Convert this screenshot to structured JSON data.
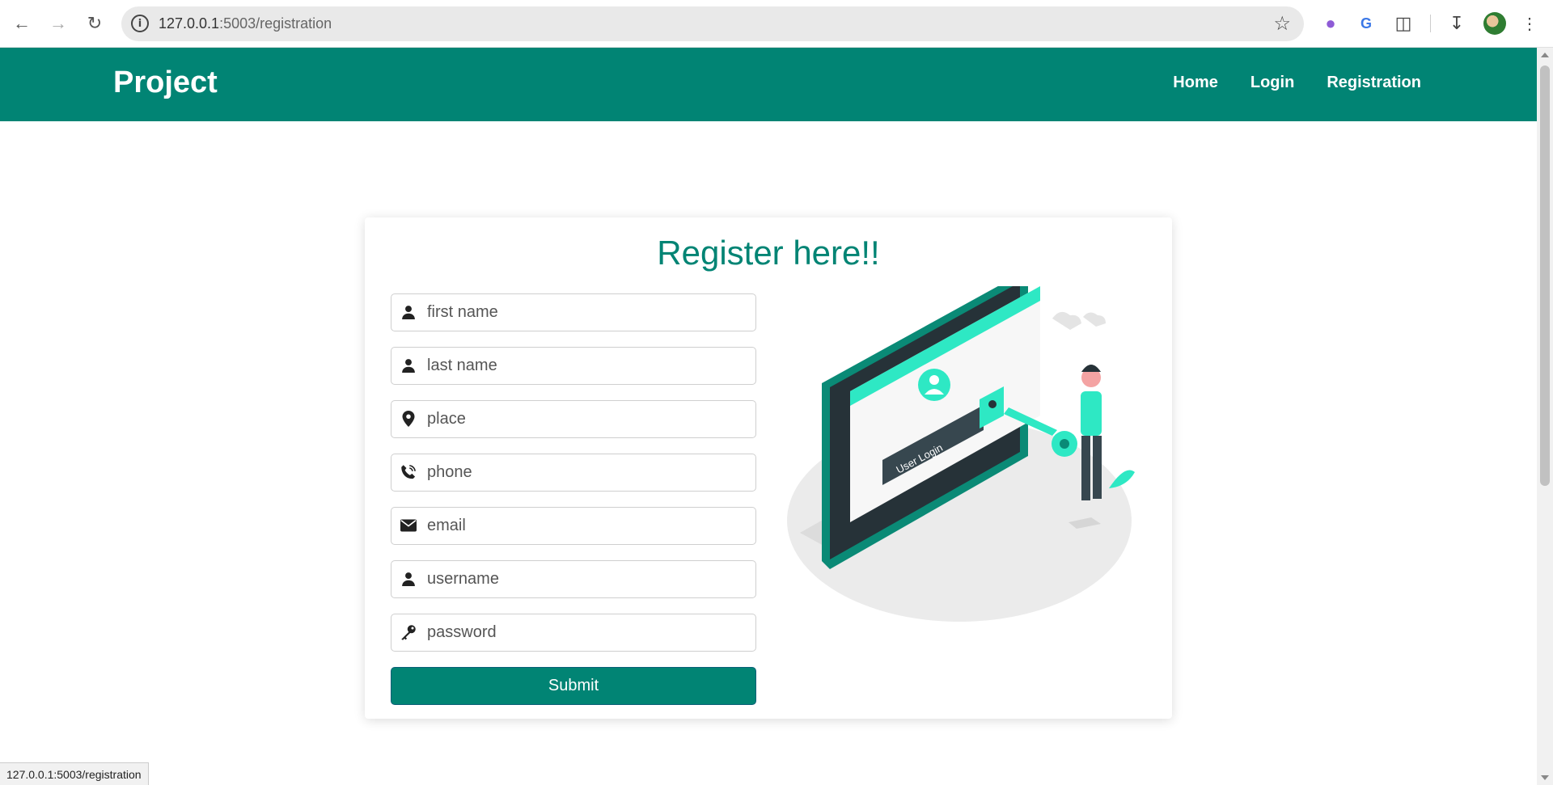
{
  "browser": {
    "url_host": "127.0.0.1",
    "url_rest": ":5003/registration"
  },
  "navbar": {
    "brand": "Project",
    "links": [
      "Home",
      "Login",
      "Registration"
    ],
    "color": "#018474"
  },
  "form": {
    "title": "Register here!!",
    "fields": [
      {
        "placeholder": "first name",
        "icon": "user-icon"
      },
      {
        "placeholder": "last name",
        "icon": "user-icon"
      },
      {
        "placeholder": "place",
        "icon": "map-marker-icon"
      },
      {
        "placeholder": "phone",
        "icon": "phone-icon"
      },
      {
        "placeholder": "email",
        "icon": "envelope-icon"
      },
      {
        "placeholder": "username",
        "icon": "user-icon"
      },
      {
        "placeholder": "password",
        "icon": "key-icon"
      }
    ],
    "submit_label": "Submit"
  },
  "illustration": {
    "screen_label": "User Login"
  },
  "status_bar": {
    "text": "127.0.0.1:5003/registration"
  }
}
